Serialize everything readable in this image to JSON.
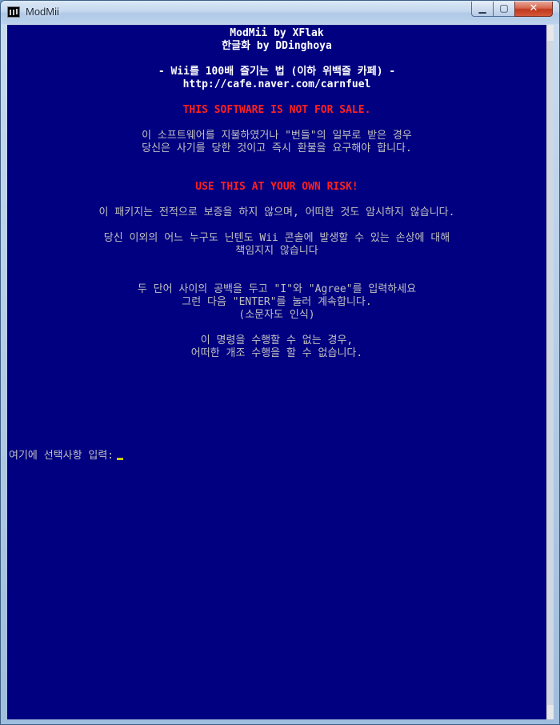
{
  "window": {
    "title": "ModMii",
    "controls": {
      "minimize": "▁",
      "maximize": "▢",
      "close": "✕"
    }
  },
  "console": {
    "header_title": "ModMii by XFlak",
    "header_credit": "한글화 by DDinghoya",
    "community_line": "- Wii를 100배 즐기는 법 (이하 위백즐 카페) -",
    "community_url": "http://cafe.naver.com/carnfuel",
    "warning_sale": "THIS SOFTWARE IS NOT FOR SALE.",
    "sale_line_1": "이 소프트웨어를 지불하였거나 \"번들\"의 일부로 받은 경우",
    "sale_line_2": "당신은 사기를 당한 것이고 즉시 환불을 요구해야 합니다.",
    "warning_risk": "USE THIS AT YOUR OWN RISK!",
    "risk_line_1": "이 패키지는 전적으로 보증을 하지 않으며, 어떠한 것도 암시하지 않습니다.",
    "risk_line_2": "당신 이외의 어느 누구도 닌텐도 Wii 콘솔에 발생할 수 있는 손상에 대해",
    "risk_line_3": "책임지지 않습니다",
    "agree_line_1": "두 단어 사이의 공백을 두고 \"I\"와 \"Agree\"를 입력하세요",
    "agree_line_2": "그런 다음 \"ENTER\"를 눌러 계속합니다.",
    "agree_line_3": "(소문자도 인식)",
    "deny_line_1": "이 명령을 수행할 수 없는 경우,",
    "deny_line_2": "어떠한 개조 수행을 할 수 없습니다.",
    "prompt_label": "여기에 선택사항 입력:"
  },
  "colors": {
    "console_bg": "#000080",
    "text": "#c0c0c0",
    "warning": "#ff2020",
    "cursor": "#c8c800"
  }
}
